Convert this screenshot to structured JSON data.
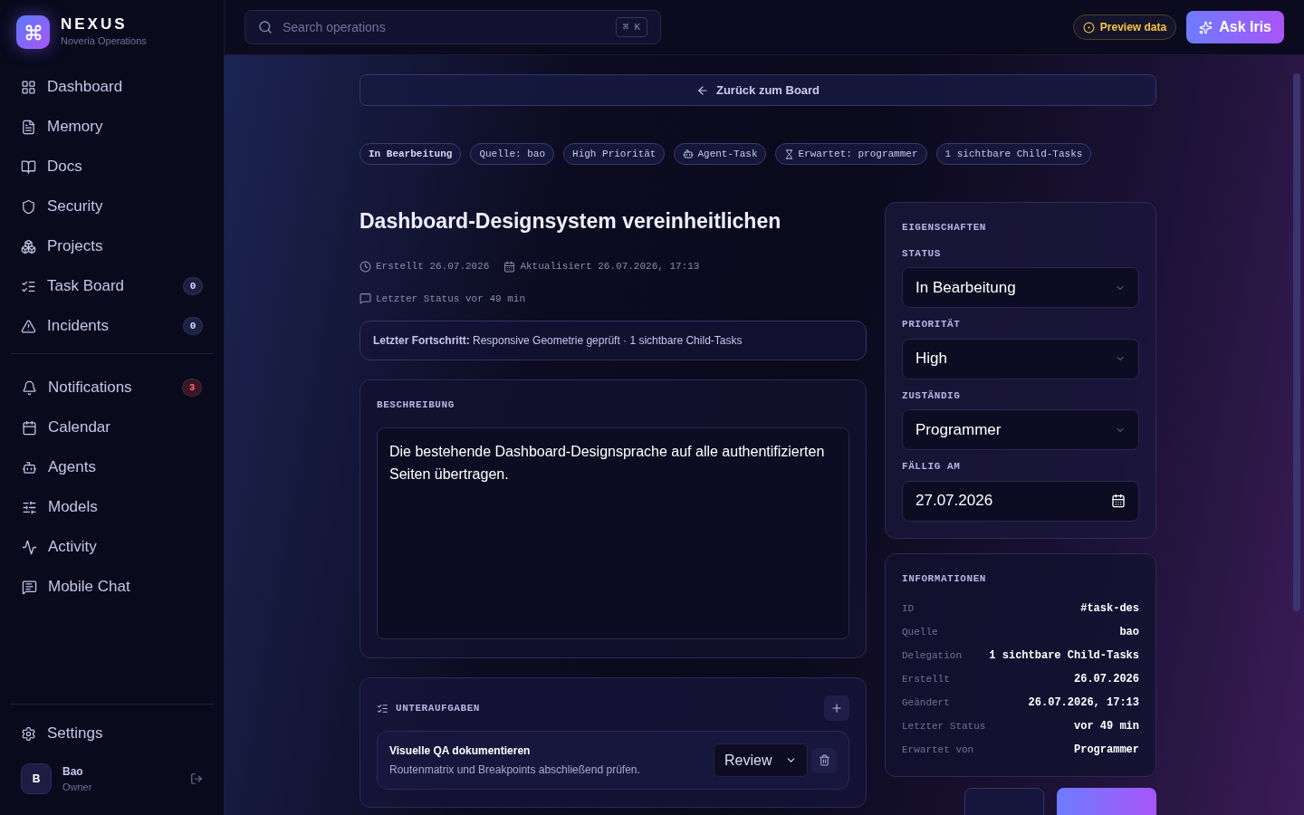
{
  "brand": {
    "name": "NEXUS",
    "subtitle": "Noveria Operations"
  },
  "nav_groups": [
    [
      {
        "label": "Dashboard",
        "selected": false
      },
      {
        "label": "Memory",
        "selected": false
      },
      {
        "label": "Docs",
        "selected": false
      },
      {
        "label": "Security",
        "selected": false
      },
      {
        "label": "Projects",
        "selected": false
      },
      {
        "label": "Task Board",
        "selected": false,
        "badge": {
          "text": "0",
          "color": "#1e1f45"
        }
      },
      {
        "label": "Incidents",
        "selected": false,
        "badge": {
          "text": "0",
          "color": "#1e1f45"
        }
      }
    ],
    [
      {
        "label": "Notifications",
        "selected": false,
        "badge": {
          "text": "3",
          "color": "#3a1524"
        }
      },
      {
        "label": "Calendar",
        "selected": false
      },
      {
        "label": "Agents",
        "selected": false
      },
      {
        "label": "Models",
        "selected": false
      },
      {
        "label": "Activity",
        "selected": false
      },
      {
        "label": "Mobile Chat",
        "selected": false
      }
    ]
  ],
  "settings": {
    "label": "Settings"
  },
  "user": {
    "initial": "B",
    "name": "Bao",
    "role": "Owner"
  },
  "search": {
    "placeholder": "Search operations",
    "shortcut": [
      "⌘",
      "K"
    ]
  },
  "preview_button": "Preview data",
  "ask_button": "Ask Iris",
  "back_button": "Zurück zum Board",
  "chips": [
    {
      "label": "In Bearbeitung",
      "kind": "status"
    },
    {
      "label": "Quelle: bao",
      "kind": "plain"
    },
    {
      "label": "High Priorität",
      "kind": "plain"
    },
    {
      "label": "Agent-Task",
      "kind": "agent"
    },
    {
      "label": "Erwartet: programmer",
      "kind": "waiting"
    },
    {
      "label": "1 sichtbare Child-Tasks",
      "kind": "plain"
    }
  ],
  "title": "Dashboard-Designsystem vereinheitlichen",
  "meta": {
    "created": "Erstellt 26.07.2026",
    "updated": "Aktualisiert 26.07.2026, 17:13",
    "last_status": "Letzter Status vor 49 min"
  },
  "progress": "**Letzter Fortschritt:** Responsive Geometrie geprüft · 1 sichtbare Child-Tasks",
  "description": {
    "heading": "BESCHREIBUNG",
    "text": "Die bestehende Dashboard-Designsprache auf alle authentifizierten Seiten übertragen."
  },
  "subtasks": {
    "heading": "UNTERAUFGABEN",
    "items": [
      {
        "title": "Visuelle QA dokumentieren",
        "text": "Routenmatrix und Breakpoints abschließend prüfen.",
        "status": "Review"
      }
    ]
  },
  "properties": {
    "heading": "EIGENSCHAFTEN",
    "fields": [
      {
        "label": "STATUS",
        "value": "In Bearbeitung",
        "kind": "select"
      },
      {
        "label": "PRIORITÄT",
        "value": "High",
        "kind": "select"
      },
      {
        "label": "ZUSTÄNDIG",
        "value": "Programmer",
        "kind": "select"
      },
      {
        "label": "FÄLLIG AM",
        "value": "27.07.2026",
        "kind": "date"
      }
    ]
  },
  "info": {
    "heading": "INFORMATIONEN",
    "rows": [
      {
        "label": "ID",
        "value": "#task-des"
      },
      {
        "label": "Quelle",
        "value": "bao"
      },
      {
        "label": "Delegation",
        "value": "1 sichtbare Child-Tasks"
      },
      {
        "label": "Erstellt",
        "value": "26.07.2026"
      },
      {
        "label": "Geändert",
        "value": "26.07.2026, 17:13"
      },
      {
        "label": "Letzter Status",
        "value": "vor 49 min"
      },
      {
        "label": "Erwartet von",
        "value": "Programmer"
      }
    ]
  }
}
